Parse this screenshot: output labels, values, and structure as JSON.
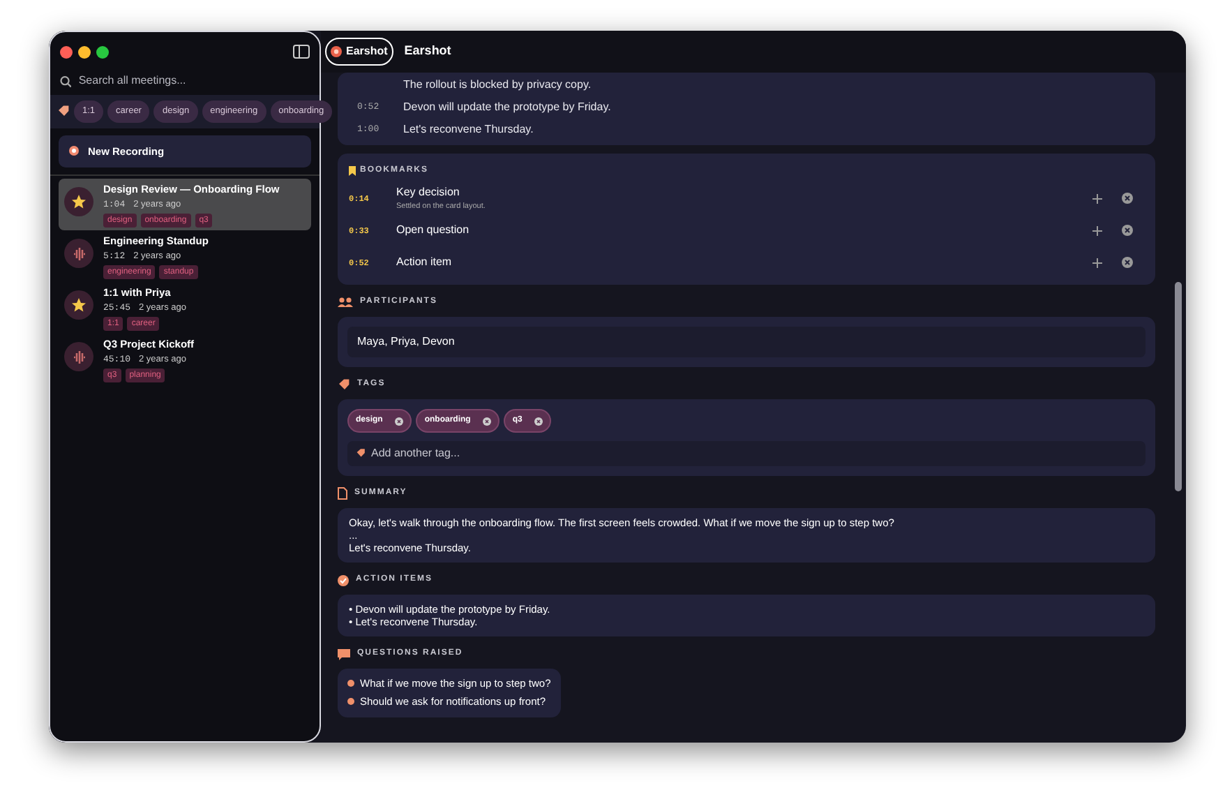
{
  "sidebar": {
    "search": {
      "placeholder": "Search all meetings..."
    },
    "tag_filters": [
      "1:1",
      "career",
      "design",
      "engineering",
      "onboarding"
    ],
    "new_recording": "New Recording",
    "meetings": [
      {
        "title": "Design Review — Onboarding Flow",
        "duration": "1:04",
        "age": "2 years ago",
        "tags": [
          "design",
          "onboarding",
          "q3"
        ],
        "starred": true,
        "selected": true
      },
      {
        "title": "Engineering Standup",
        "duration": "5:12",
        "age": "2 years ago",
        "tags": [
          "engineering",
          "standup"
        ],
        "starred": false,
        "selected": false
      },
      {
        "title": "1:1 with Priya",
        "duration": "25:45",
        "age": "2 years ago",
        "tags": [
          "1:1",
          "career"
        ],
        "starred": true,
        "selected": false
      },
      {
        "title": "Q3 Project Kickoff",
        "duration": "45:10",
        "age": "2 years ago",
        "tags": [
          "q3",
          "planning"
        ],
        "starred": false,
        "selected": false
      }
    ]
  },
  "header": {
    "app_button": "Earshot",
    "title": "Earshot"
  },
  "transcript": [
    {
      "text": "The rollout is blocked by privacy copy."
    },
    {
      "time": "0:52",
      "text": "Devon will update the prototype by Friday."
    },
    {
      "time": "1:00",
      "text": "Let's reconvene Thursday."
    }
  ],
  "bookmarks": {
    "heading": "BOOKMARKS",
    "items": [
      {
        "time": "0:14",
        "label": "Key decision",
        "note": "Settled on the card layout."
      },
      {
        "time": "0:33",
        "label": "Open question"
      },
      {
        "time": "0:52",
        "label": "Action item"
      }
    ]
  },
  "participants": {
    "heading": "PARTICIPANTS",
    "value": "Maya, Priya, Devon"
  },
  "tags": {
    "heading": "TAGS",
    "items": [
      "design",
      "onboarding",
      "q3"
    ],
    "placeholder": "Add another tag..."
  },
  "summary": {
    "heading": "SUMMARY",
    "lines": [
      "Okay, let's walk through the onboarding flow. The first screen feels crowded. What if we move the sign up to step two?",
      "...",
      "Let's reconvene Thursday."
    ]
  },
  "action_items": {
    "heading": "ACTION ITEMS",
    "items": [
      "• Devon will update the prototype by Friday.",
      "• Let's reconvene Thursday."
    ]
  },
  "questions": {
    "heading": "QUESTIONS RAISED",
    "items": [
      "What if we move the sign up to step two?",
      "Should we ask for notifications up front?"
    ]
  }
}
